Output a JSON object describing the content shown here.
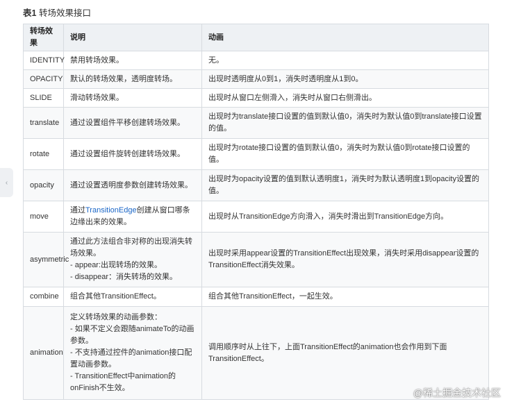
{
  "caption": {
    "number": "表1",
    "title": "转场效果接口"
  },
  "table": {
    "headers": [
      "转场效果",
      "说明",
      "动画"
    ],
    "rows": [
      {
        "name": "IDENTITY",
        "desc": [
          "禁用转场效果。"
        ],
        "anim": "无。"
      },
      {
        "name": "OPACITY",
        "desc": [
          "默认的转场效果，透明度转场。"
        ],
        "anim": "出现时透明度从0到1，消失时透明度从1到0。"
      },
      {
        "name": "SLIDE",
        "desc": [
          "滑动转场效果。"
        ],
        "anim": "出现时从窗口左侧滑入，消失时从窗口右侧滑出。"
      },
      {
        "name": "translate",
        "desc": [
          "通过设置组件平移创建转场效果。"
        ],
        "anim": "出现时为translate接口设置的值到默认值0，消失时为默认值0到translate接口设置的值。"
      },
      {
        "name": "rotate",
        "desc": [
          "通过设置组件旋转创建转场效果。"
        ],
        "anim": "出现时为rotate接口设置的值到默认值0，消失时为默认值0到rotate接口设置的值。"
      },
      {
        "name": "opacity",
        "desc": [
          "通过设置透明度参数创建转场效果。"
        ],
        "anim": "出现时为opacity设置的值到默认透明度1，消失时为默认透明度1到opacity设置的值。"
      },
      {
        "name": "move",
        "desc_pre": "通过",
        "desc_link": "TransitionEdge",
        "desc_post": "创建从窗口哪条边缘出来的效果。",
        "anim": "出现时从TransitionEdge方向滑入，消失时滑出到TransitionEdge方向。"
      },
      {
        "name": "asymmetric",
        "desc": [
          "通过此方法组合非对称的出现消失转场效果。",
          "- appear:出现转场的效果。",
          "- disappear：消失转场的效果。"
        ],
        "anim": "出现时采用appear设置的TransitionEffect出现效果，消失时采用disappear设置的TransitionEffect消失效果。"
      },
      {
        "name": "combine",
        "desc": [
          "组合其他TransitionEffect。"
        ],
        "anim": "组合其他TransitionEffect，一起生效。"
      },
      {
        "name": "animation",
        "desc": [
          "定义转场效果的动画参数：",
          "- 如果不定义会跟随animateTo的动画参数。",
          "- 不支持通过控件的animation接口配置动画参数。",
          "- TransitionEffect中animation的onFinish不生效。"
        ],
        "anim": "调用顺序时从上往下，上面TransitionEffect的animation也会作用到下面TransitionEffect。"
      }
    ]
  },
  "watermark": "@稀土掘金技术社区"
}
